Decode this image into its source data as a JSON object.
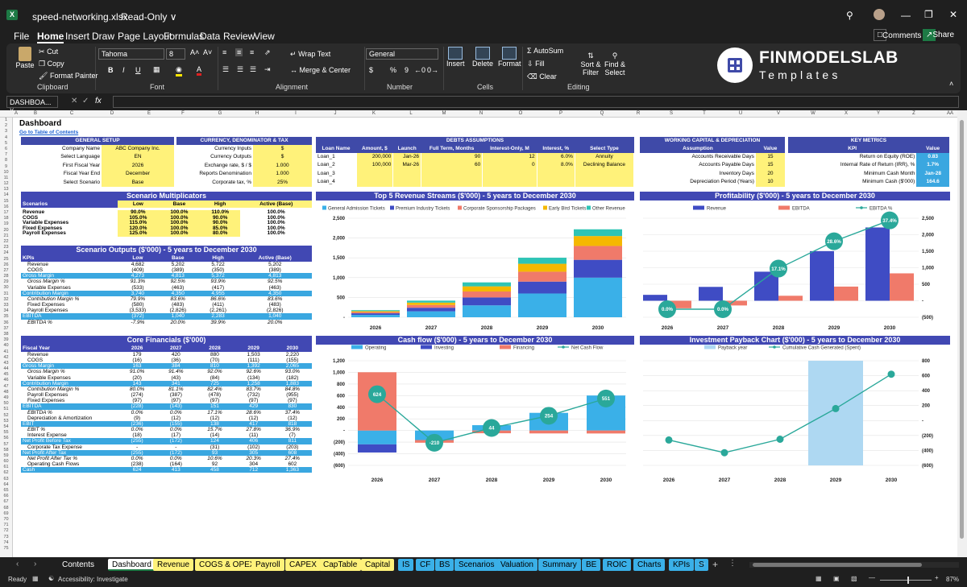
{
  "window": {
    "filename": "speed-networking.xlsx",
    "mode": "Read-Only ∨"
  },
  "menu": [
    "File",
    "Home",
    "Insert",
    "Draw",
    "Page Layout",
    "Formulas",
    "Data",
    "Review",
    "View"
  ],
  "menu_right": {
    "comments": "Comments",
    "share": "Share"
  },
  "ribbon": {
    "clipboard": {
      "paste": "Paste",
      "cut": "Cut",
      "copy": "Copy",
      "format_painter": "Format Painter",
      "label": "Clipboard"
    },
    "font": {
      "name": "Tahoma",
      "size": "8",
      "label": "Font"
    },
    "alignment": {
      "wrap": "Wrap Text",
      "merge": "Merge & Center",
      "label": "Alignment"
    },
    "number": {
      "format": "General",
      "label": "Number"
    },
    "cells": {
      "insert": "Insert",
      "delete": "Delete",
      "format": "Format",
      "label": "Cells"
    },
    "editing": {
      "autosum": "AutoSum",
      "fill": "Fill",
      "clear": "Clear",
      "sort": "Sort & Filter",
      "find": "Find & Select",
      "label": "Editing"
    }
  },
  "brand": {
    "name": "FINMODELSLAB",
    "sub": "Templates"
  },
  "formula": {
    "namebox": "DASHBOA..."
  },
  "columns": [
    "A",
    "B",
    "C",
    "D",
    "E",
    "F",
    "G",
    "H",
    "I",
    "J",
    "K",
    "L",
    "M",
    "N",
    "O",
    "P",
    "Q",
    "R",
    "S",
    "T",
    "U",
    "V",
    "W",
    "X",
    "Y",
    "Z",
    "AA",
    "AB",
    "AC",
    "AD"
  ],
  "sheet": {
    "title": "Dashboard",
    "toc_link": "Go to Table of Contents"
  },
  "general_setup": {
    "title": "GENERAL SETUP",
    "rows": [
      [
        "Company Name",
        "ABC Company Inc."
      ],
      [
        "Select Language",
        "EN"
      ],
      [
        "First Fiscal Year",
        "2026"
      ],
      [
        "Fiscal Year End",
        "December"
      ],
      [
        "Select Scenario",
        "Base"
      ]
    ]
  },
  "currency": {
    "title": "CURRENCY, DENOMINATOR & TAX",
    "rows": [
      [
        "Currency Inputs",
        "$"
      ],
      [
        "Currency Outputs",
        "$"
      ],
      [
        "Exchange rate, $ / $",
        "1.000"
      ],
      [
        "Reports Denomination",
        "1.000"
      ],
      [
        "Corporate tax, %",
        "25%"
      ]
    ]
  },
  "debts": {
    "title": "DEBTS ASSUMPTIONS",
    "headers": [
      "Loan Name",
      "Amount, $",
      "Launch",
      "Full Term, Months",
      "Interest-Only, M",
      "Interest, %",
      "Select Type"
    ],
    "rows": [
      [
        "Loan_1",
        "200,000",
        "Jan-26",
        "90",
        "12",
        "6.0%",
        "Annuity"
      ],
      [
        "Loan_2",
        "100,000",
        "Mar-26",
        "60",
        "0",
        "8.0%",
        "Declining Balance"
      ],
      [
        "Loan_3",
        "",
        "",
        "",
        "",
        "",
        ""
      ],
      [
        "Loan_4",
        "",
        "",
        "",
        "",
        "",
        ""
      ]
    ]
  },
  "working_capital": {
    "title": "WORKING CAPITAL & DEPRECIATION",
    "headers": [
      "Assumption",
      "Value"
    ],
    "rows": [
      [
        "Accounts Receivable Days",
        "15"
      ],
      [
        "Accounts Payable Days",
        "15"
      ],
      [
        "Inventory Days",
        "20"
      ],
      [
        "Depreciation Period (Years)",
        "10"
      ]
    ]
  },
  "key_metrics": {
    "title": "KEY METRICS",
    "headers": [
      "KPI",
      "Value"
    ],
    "rows": [
      [
        "Return on Equity (ROE)",
        "0.83"
      ],
      [
        "Internal Rate of Return (IRR), %",
        "1.7%"
      ],
      [
        "Minimum Cash Month",
        "Jan-28"
      ],
      [
        "Minimum Cash ($'000)",
        "164.6"
      ]
    ]
  },
  "scenario_multipliers": {
    "title": "Scenario Multiplicators",
    "headers": [
      "Scenarios",
      "Low",
      "Base",
      "High",
      "Active (Base)"
    ],
    "rows": [
      [
        "Revenue",
        "90.0%",
        "100.0%",
        "110.0%",
        "100.0%"
      ],
      [
        "COGS",
        "105.0%",
        "100.0%",
        "90.0%",
        "100.0%"
      ],
      [
        "Variable Expenses",
        "115.0%",
        "100.0%",
        "90.0%",
        "100.0%"
      ],
      [
        "Fixed Expenses",
        "120.0%",
        "100.0%",
        "85.0%",
        "100.0%"
      ],
      [
        "Payroll Expenses",
        "125.0%",
        "100.0%",
        "80.0%",
        "100.0%"
      ]
    ]
  },
  "scenario_outputs": {
    "title": "Scenario Outputs ($'000) - 5 years to December 2030",
    "headers": [
      "KPIs",
      "Low",
      "Base",
      "High",
      "Active (Base)"
    ],
    "rows": [
      [
        "Revenue",
        "4,682",
        "5,202",
        "5,722",
        "5,202",
        ""
      ],
      [
        "COGS",
        "(409)",
        "(389)",
        "(350)",
        "(389)",
        ""
      ],
      [
        "Gross Margin",
        "4,273",
        "4,813",
        "5,372",
        "4,813",
        "b"
      ],
      [
        "Gross Margin %",
        "91.3%",
        "92.5%",
        "93.9%",
        "92.5%",
        "i"
      ],
      [
        "Variable Expenses",
        "(533)",
        "(463)",
        "(417)",
        "(463)",
        ""
      ],
      [
        "Contribution Margin",
        "3,740",
        "4,350",
        "4,955",
        "4,350",
        "b"
      ],
      [
        "Contribution Margin %",
        "79.9%",
        "83.6%",
        "86.6%",
        "83.6%",
        "i"
      ],
      [
        "Fixed Expenses",
        "(580)",
        "(483)",
        "(411)",
        "(483)",
        ""
      ],
      [
        "Payroll Expenses",
        "(3,533)",
        "(2,826)",
        "(2,261)",
        "(2,826)",
        ""
      ],
      [
        "EBITDA",
        "(372)",
        "1,040",
        "2,283",
        "1,040",
        "b"
      ],
      [
        "EBITDA %",
        "-7.9%",
        "20.0%",
        "39.9%",
        "20.0%",
        "i"
      ]
    ]
  },
  "core": {
    "title": "Core Financials ($'000)",
    "headers": [
      "Fiscal Year",
      "2026",
      "2027",
      "2028",
      "2029",
      "2030"
    ],
    "rows": [
      [
        "Revenue",
        "179",
        "420",
        "880",
        "1,503",
        "2,220",
        ""
      ],
      [
        "COGS",
        "(16)",
        "(36)",
        "(70)",
        "(111)",
        "(155)",
        ""
      ],
      [
        "Gross Margin",
        "163",
        "384",
        "810",
        "1,392",
        "2,065",
        "b"
      ],
      [
        "Gross Margin %",
        "91.0%",
        "91.4%",
        "92.0%",
        "92.6%",
        "93.0%",
        "i"
      ],
      [
        "Variable Expenses",
        "(20)",
        "(43)",
        "(84)",
        "(134)",
        "(182)",
        ""
      ],
      [
        "Contribution Margin",
        "143",
        "341",
        "725",
        "1,258",
        "1,883",
        "b"
      ],
      [
        "Contribution Margin %",
        "80.0%",
        "81.1%",
        "82.4%",
        "83.7%",
        "84.8%",
        "i"
      ],
      [
        "Payroll Expenses",
        "(274)",
        "(387)",
        "(478)",
        "(732)",
        "(955)",
        ""
      ],
      [
        "Fixed Expenses",
        "(97)",
        "(97)",
        "(97)",
        "(97)",
        "(97)",
        ""
      ],
      [
        "EBITDA",
        "(228)",
        "(143)",
        "151",
        "429",
        "830",
        "b"
      ],
      [
        "EBITDA %",
        "0.0%",
        "0.0%",
        "17.1%",
        "28.6%",
        "37.4%",
        "i"
      ],
      [
        "Depreciation & Amortization",
        "(9)",
        "(12)",
        "(12)",
        "(12)",
        "(12)",
        ""
      ],
      [
        "EBIT",
        "(236)",
        "(155)",
        "138",
        "417",
        "818",
        "b"
      ],
      [
        "EBIT %",
        "0.0%",
        "0.0%",
        "15.7%",
        "27.8%",
        "36.9%",
        "i"
      ],
      [
        "Interest Expense",
        "(18)",
        "(17)",
        "(14)",
        "(11)",
        "(7)",
        ""
      ],
      [
        "Net Profit Before Tax",
        "(255)",
        "(172)",
        "124",
        "406",
        "811",
        "b"
      ],
      [
        "Corporate Tax Expense",
        "-",
        "-",
        "(31)",
        "(102)",
        "(203)",
        ""
      ],
      [
        "Net Profit After Tax",
        "(255)",
        "(172)",
        "93",
        "305",
        "608",
        "b"
      ],
      [
        "Net Profit After Tax %",
        "0.0%",
        "0.0%",
        "10.6%",
        "20.3%",
        "27.4%",
        "i"
      ],
      [
        "Operating Cash Flows",
        "(238)",
        "(164)",
        "92",
        "304",
        "602",
        ""
      ],
      [
        "Cash",
        "624",
        "413",
        "458",
        "712",
        "1,363",
        "b"
      ]
    ]
  },
  "chart_data": [
    {
      "type": "bar",
      "title": "Top 5 Revenue Streams ($'000) - 5 years to December 2030",
      "categories": [
        "2026",
        "2027",
        "2028",
        "2029",
        "2030"
      ],
      "ylim": [
        0,
        2500
      ],
      "yticks": [
        "2,500",
        "2,000",
        "1,500",
        "1,000",
        "500",
        "-"
      ],
      "series": [
        {
          "name": "General Admission Tickets",
          "color": "#3ab0e8",
          "values": [
            60,
            150,
            300,
            600,
            1000
          ]
        },
        {
          "name": "Premium Industry Tickets",
          "color": "#3f4cc4",
          "values": [
            40,
            90,
            200,
            300,
            450
          ]
        },
        {
          "name": "Corporate Sponsorship Packages",
          "color": "#f07a6a",
          "values": [
            30,
            70,
            150,
            250,
            350
          ]
        },
        {
          "name": "Early Bird Tickets",
          "color": "#f5b800",
          "values": [
            25,
            60,
            130,
            200,
            250
          ]
        },
        {
          "name": "Other Revenue",
          "color": "#2ec4b6",
          "values": [
            24,
            50,
            100,
            153,
            170
          ]
        }
      ]
    },
    {
      "type": "bar",
      "title": "Profitability ($'000) - 5 years to December 2030",
      "categories": [
        "2026",
        "2027",
        "2028",
        "2029",
        "2030"
      ],
      "ylim": [
        -500,
        2500
      ],
      "yticks": [
        "2,500",
        "2,000",
        "1,500",
        "1,000",
        "500",
        "-",
        "(500)"
      ],
      "series": [
        {
          "name": "Revenue",
          "color": "#3f4cc4",
          "values": [
            179,
            420,
            880,
            1503,
            2220
          ]
        },
        {
          "name": "EBITDA",
          "color": "#f07a6a",
          "values": [
            -228,
            -143,
            151,
            429,
            830
          ]
        },
        {
          "name": "EBITDA %",
          "color": "#2aa89a",
          "line": true,
          "values": [
            0.0,
            0.0,
            17.1,
            28.6,
            37.4
          ],
          "labels": [
            "0.0%",
            "0.0%",
            "17.1%",
            "28.6%",
            "37.4%"
          ]
        }
      ]
    },
    {
      "type": "bar",
      "title": "Cash flow ($'000) - 5 years to December 2030",
      "categories": [
        "2026",
        "2027",
        "2028",
        "2029",
        "2030"
      ],
      "ylim": [
        -600,
        1200
      ],
      "yticks": [
        "1,200",
        "1,000",
        "800",
        "600",
        "400",
        "200",
        "-",
        "(200)",
        "(400)",
        "(600)"
      ],
      "series": [
        {
          "name": "Operating",
          "color": "#3ab0e8",
          "values": [
            -238,
            -164,
            92,
            304,
            602
          ]
        },
        {
          "name": "Investing",
          "color": "#3f4cc4",
          "values": [
            -140,
            0,
            0,
            0,
            0
          ]
        },
        {
          "name": "Financing",
          "color": "#f07a6a",
          "values": [
            1002,
            -46,
            -47,
            -50,
            -51
          ]
        },
        {
          "name": "Net Cash Flow",
          "color": "#2aa89a",
          "line": true,
          "values": [
            624,
            -210,
            44,
            254,
            551
          ],
          "labels": [
            "624",
            "-210",
            "44",
            "254",
            "551"
          ]
        }
      ]
    },
    {
      "type": "line",
      "title": "Investment Payback Chart ($'000) - 5 years to December 2030",
      "categories": [
        "2026",
        "2027",
        "2028",
        "2029",
        "2030"
      ],
      "ylim": [
        -600,
        800
      ],
      "yticks": [
        "800",
        "600",
        "400",
        "200",
        "-",
        "(200)",
        "(400)",
        "(600)"
      ],
      "payback_index": 3,
      "series": [
        {
          "name": "Payback year",
          "color": "#aed8f2"
        },
        {
          "name": "Cumulative Cash Generated (Spent)",
          "color": "#2aa89a",
          "values": [
            -260,
            -430,
            -250,
            160,
            620
          ]
        }
      ]
    }
  ],
  "tabs": [
    {
      "label": "Contents",
      "c": "none"
    },
    {
      "label": "Dashboard",
      "c": "active"
    },
    {
      "label": "Revenue",
      "c": "#fff27a"
    },
    {
      "label": "COGS & OPEX",
      "c": "#fff27a"
    },
    {
      "label": "Payroll",
      "c": "#fff27a"
    },
    {
      "label": "CAPEX",
      "c": "#fff27a"
    },
    {
      "label": "CapTable",
      "c": "#fff27a"
    },
    {
      "label": "Capital",
      "c": "#fff27a"
    },
    {
      "label": "IS",
      "c": "#3ab0e8"
    },
    {
      "label": "CF",
      "c": "#3ab0e8"
    },
    {
      "label": "BS",
      "c": "#3ab0e8"
    },
    {
      "label": "Scenarios",
      "c": "#3ab0e8"
    },
    {
      "label": "Valuation",
      "c": "#3ab0e8"
    },
    {
      "label": "Summary",
      "c": "#3ab0e8"
    },
    {
      "label": "BE",
      "c": "#3ab0e8"
    },
    {
      "label": "ROIC",
      "c": "#3ab0e8"
    },
    {
      "label": "Charts",
      "c": "#3ab0e8"
    },
    {
      "label": "KPIs",
      "c": "#3ab0e8"
    },
    {
      "label": "S",
      "c": "#3ab0e8"
    }
  ],
  "status": {
    "ready": "Ready",
    "accessibility": "Accessibility: Investigate",
    "zoom": "87%"
  }
}
